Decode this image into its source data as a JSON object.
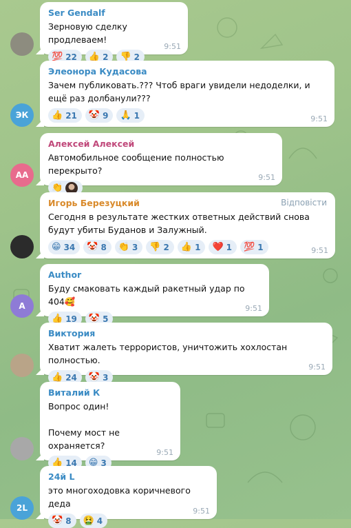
{
  "messages": [
    {
      "name": "Ser Gendalf",
      "name_color": "#3a8bc4",
      "avatar_initials": "",
      "avatar_color": "#8d8c7f",
      "text": "Зерновую сделку продлеваем!",
      "reactions": [
        {
          "emoji": "💯",
          "icon": "hundred-icon",
          "count": "22"
        },
        {
          "emoji": "👍",
          "icon": "thumbs-up-icon",
          "count": "2"
        },
        {
          "emoji": "👎",
          "icon": "thumbs-down-icon",
          "count": "2"
        }
      ],
      "time": "9:51"
    },
    {
      "name": "Элеонора Кудасова",
      "name_color": "#3a8bc4",
      "avatar_initials": "ЭК",
      "avatar_color": "#4aa3d8",
      "text": "Зачем публиковать.??? Чтоб враги увидели недоделки, и ещё раз долбанули???",
      "reactions": [
        {
          "emoji": "👍",
          "icon": "thumbs-up-icon",
          "count": "21"
        },
        {
          "emoji": "🤡",
          "icon": "clown-icon",
          "count": "9"
        },
        {
          "emoji": "🙏",
          "icon": "pray-icon",
          "count": "1"
        }
      ],
      "time": "9:51"
    },
    {
      "name": "Алексей Алексей",
      "name_color": "#c0487a",
      "avatar_initials": "АА",
      "avatar_color": "#e86b8d",
      "text": "Автомобильное сообщение полностью перекрыто?",
      "reactions": [
        {
          "emoji": "👏",
          "icon": "clap-icon",
          "count": ""
        }
      ],
      "time": "9:51"
    },
    {
      "name": "Игорь Березуцкий",
      "name_color": "#d98a2b",
      "avatar_initials": "",
      "avatar_color": "#2b2b2b",
      "reply_label": "Відповісти",
      "text": "Сегодня в результате жестких ответных действий снова будут убиты Буданов и Залужный.",
      "reactions": [
        {
          "emoji": "😁",
          "icon": "grin-icon",
          "count": "34"
        },
        {
          "emoji": "🤡",
          "icon": "clown-icon",
          "count": "8"
        },
        {
          "emoji": "👏",
          "icon": "clap-icon",
          "count": "3"
        },
        {
          "emoji": "👎",
          "icon": "thumbs-down-icon",
          "count": "2"
        },
        {
          "emoji": "👍",
          "icon": "thumbs-up-icon",
          "count": "1"
        },
        {
          "emoji": "❤️",
          "icon": "heart-icon",
          "count": "1"
        },
        {
          "emoji": "💯",
          "icon": "hundred-icon",
          "count": "1"
        }
      ],
      "time": "9:51"
    },
    {
      "name": "Author",
      "name_color": "#3a8bc4",
      "avatar_initials": "A",
      "avatar_color": "#8e7bd6",
      "text": "Буду смаковать каждый ракетный удар по 404🥰",
      "reactions": [
        {
          "emoji": "👍",
          "icon": "thumbs-up-icon",
          "count": "19"
        },
        {
          "emoji": "🤡",
          "icon": "clown-icon",
          "count": "5"
        }
      ],
      "time": "9:51"
    },
    {
      "name": "Виктория",
      "name_color": "#3a8bc4",
      "avatar_initials": "",
      "avatar_color": "#b9a488",
      "text": "Хватит жалеть террористов, уничтожить хохлостан полностью.",
      "reactions": [
        {
          "emoji": "👍",
          "icon": "thumbs-up-icon",
          "count": "24"
        },
        {
          "emoji": "🤡",
          "icon": "clown-icon",
          "count": "3"
        }
      ],
      "time": "9:51"
    },
    {
      "name": "Виталий К",
      "name_color": "#3a8bc4",
      "avatar_initials": "",
      "avatar_color": "#a8a8a8",
      "text": "Вопрос один!\n\nПочему мост не охраняется?",
      "reactions": [
        {
          "emoji": "👍",
          "icon": "thumbs-up-icon",
          "count": "14"
        },
        {
          "emoji": "😁",
          "icon": "grin-icon",
          "count": "3"
        }
      ],
      "time": "9:51"
    },
    {
      "name": "24й L",
      "name_color": "#3a8bc4",
      "avatar_initials": "2L",
      "avatar_color": "#4aa3d8",
      "text": "это многоходовка коричневого деда",
      "reactions": [
        {
          "emoji": "🤡",
          "icon": "clown-icon",
          "count": "8"
        },
        {
          "emoji": "🤮",
          "icon": "vomit-icon",
          "count": "4"
        }
      ],
      "time": "9:51"
    }
  ]
}
